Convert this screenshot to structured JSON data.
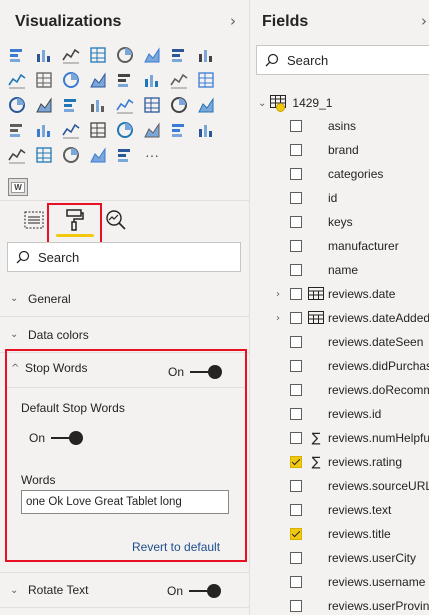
{
  "visualizations": {
    "title": "Visualizations",
    "gallery": [
      "stacked-bar-chart-icon",
      "stacked-column-chart-icon",
      "clustered-bar-chart-icon",
      "clustered-column-chart-icon",
      "100-bar-chart-icon",
      "100-column-chart-icon",
      "line-chart-icon",
      "area-chart-icon",
      "stacked-area-chart-icon",
      "line-column-chart-icon",
      "line-clustered-column-chart-icon",
      "ribbon-chart-icon",
      "waterfall-chart-icon",
      "funnel-chart-icon",
      "scatter-chart-icon",
      "pie-chart-icon",
      "donut-chart-icon",
      "treemap-icon",
      "map-icon",
      "filled-map-icon",
      "gauge-icon",
      "card-icon",
      "multi-row-card-icon",
      "kpi-icon",
      "slicer-icon",
      "table-icon",
      "matrix-icon",
      "r-visual-icon",
      "python-visual-icon",
      "key-influencers-icon",
      "decomposition-tree-icon",
      "qa-icon",
      "smart-narrative-icon",
      "paginated-report-icon",
      "arcgis-icon",
      "power-apps-icon",
      "power-automate-icon",
      "more-icon"
    ],
    "more_label": "···",
    "custom_chip": "W",
    "format_search_placeholder": "Search",
    "sections": {
      "general": "General",
      "data_colors": "Data colors",
      "stop_words": "Stop Words",
      "rotate_text": "Rotate Text"
    },
    "stop_words": {
      "toggle_label": "On",
      "default_label": "Default Stop Words",
      "default_toggle": "On",
      "words_label": "Words",
      "words_value": "one Ok Love Great Tablet long",
      "revert": "Revert to default"
    },
    "rotate_toggle": "On"
  },
  "fields": {
    "title": "Fields",
    "search_placeholder": "Search",
    "table_name": "1429_1",
    "items": [
      {
        "name": "asins",
        "checked": false,
        "icon": "",
        "expandable": false
      },
      {
        "name": "brand",
        "checked": false,
        "icon": "",
        "expandable": false
      },
      {
        "name": "categories",
        "checked": false,
        "icon": "",
        "expandable": false
      },
      {
        "name": "id",
        "checked": false,
        "icon": "",
        "expandable": false
      },
      {
        "name": "keys",
        "checked": false,
        "icon": "",
        "expandable": false
      },
      {
        "name": "manufacturer",
        "checked": false,
        "icon": "",
        "expandable": false
      },
      {
        "name": "name",
        "checked": false,
        "icon": "",
        "expandable": false
      },
      {
        "name": "reviews.date",
        "checked": false,
        "icon": "calendar",
        "expandable": true
      },
      {
        "name": "reviews.dateAdded",
        "checked": false,
        "icon": "calendar",
        "expandable": true
      },
      {
        "name": "reviews.dateSeen",
        "checked": false,
        "icon": "",
        "expandable": false
      },
      {
        "name": "reviews.didPurchase",
        "checked": false,
        "icon": "",
        "expandable": false
      },
      {
        "name": "reviews.doRecommend",
        "checked": false,
        "icon": "",
        "expandable": false
      },
      {
        "name": "reviews.id",
        "checked": false,
        "icon": "",
        "expandable": false
      },
      {
        "name": "reviews.numHelpful",
        "checked": false,
        "icon": "sigma",
        "expandable": false
      },
      {
        "name": "reviews.rating",
        "checked": true,
        "icon": "sigma",
        "expandable": false
      },
      {
        "name": "reviews.sourceURLs",
        "checked": false,
        "icon": "",
        "expandable": false
      },
      {
        "name": "reviews.text",
        "checked": false,
        "icon": "",
        "expandable": false
      },
      {
        "name": "reviews.title",
        "checked": true,
        "icon": "",
        "expandable": false
      },
      {
        "name": "reviews.userCity",
        "checked": false,
        "icon": "",
        "expandable": false
      },
      {
        "name": "reviews.username",
        "checked": false,
        "icon": "",
        "expandable": false
      },
      {
        "name": "reviews.userProvince",
        "checked": false,
        "icon": "",
        "expandable": false
      }
    ]
  },
  "colors": {
    "accent_yellow": "#f2c811",
    "highlight_red": "#e81123",
    "link_blue": "#1f4e8c",
    "pane_bg": "#f3f2f1"
  }
}
